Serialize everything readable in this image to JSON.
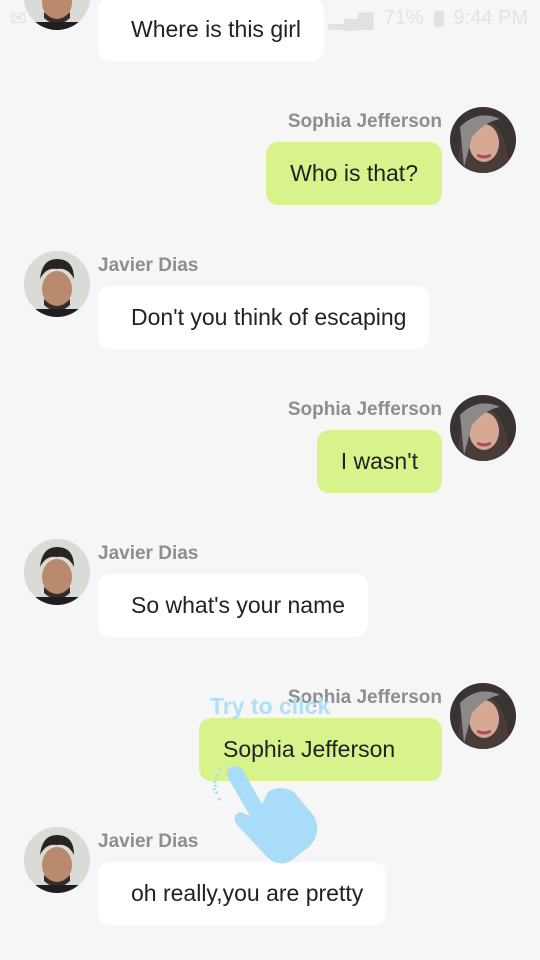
{
  "status_bar": {
    "battery": "71%",
    "time": "9:44 PM"
  },
  "messages": [
    {
      "side": "left",
      "name": "",
      "text": "Where is this girl",
      "avatar": "male-avatar"
    },
    {
      "side": "right",
      "name": "Sophia Jefferson",
      "text": "Who is that?",
      "avatar": "female-avatar"
    },
    {
      "side": "left",
      "name": "Javier Dias",
      "text": "Don't you think of escaping",
      "avatar": "male-avatar"
    },
    {
      "side": "right",
      "name": "Sophia Jefferson",
      "text": "I wasn't",
      "avatar": "female-avatar"
    },
    {
      "side": "left",
      "name": "Javier Dias",
      "text": "So what's your name",
      "avatar": "male-avatar"
    },
    {
      "side": "right",
      "name": "Sophia Jefferson",
      "text": "Sophia Jefferson",
      "avatar": "female-avatar"
    },
    {
      "side": "left",
      "name": "Javier Dias",
      "text": "oh really,you are pretty",
      "avatar": "male-avatar"
    }
  ],
  "hint": {
    "text": "Try to click",
    "icon": "pointing-hand-icon"
  },
  "colors": {
    "background": "#f6f6f6",
    "outgoing_bubble": "#d8f38b",
    "incoming_bubble": "#ffffff",
    "name_text": "#8e8e8e",
    "hint": "#aee0fa"
  }
}
